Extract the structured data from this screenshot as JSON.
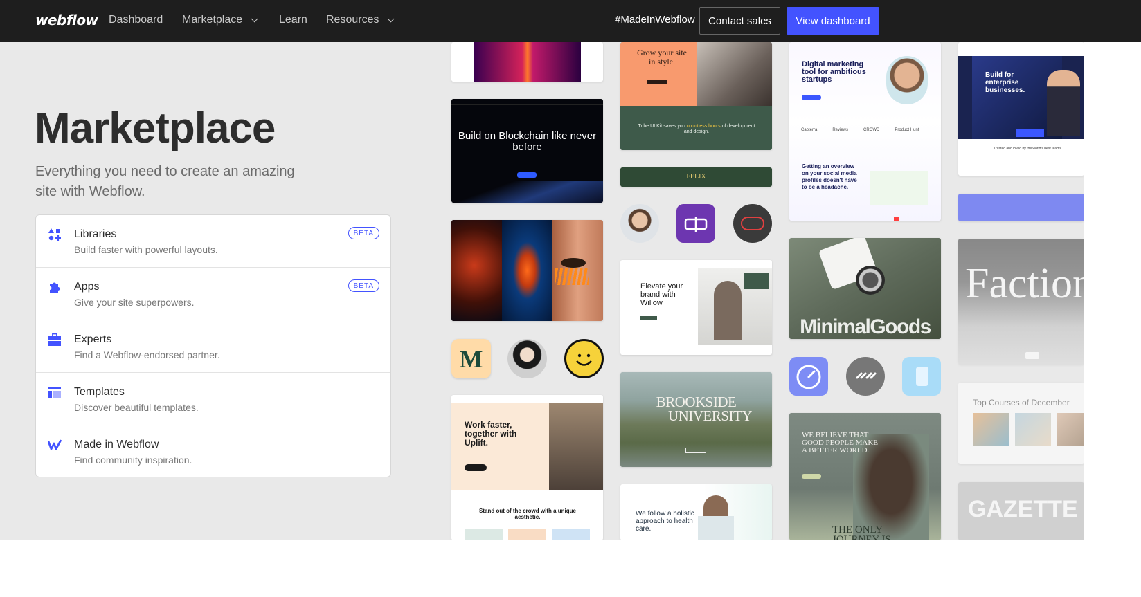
{
  "nav": {
    "logo": "webflow",
    "links": [
      {
        "label": "Dashboard",
        "has_dropdown": false
      },
      {
        "label": "Marketplace",
        "has_dropdown": true
      },
      {
        "label": "Learn",
        "has_dropdown": false
      },
      {
        "label": "Resources",
        "has_dropdown": true
      }
    ],
    "made_in_webflow": "#MadeInWebflow",
    "contact_sales": "Contact sales",
    "view_dashboard": "View dashboard"
  },
  "hero": {
    "title": "Marketplace",
    "subtitle": "Everything you need to create an amazing site with Webflow."
  },
  "menu": [
    {
      "title": "Libraries",
      "desc": "Build faster with powerful layouts.",
      "badge": "BETA",
      "icon": "libraries-icon"
    },
    {
      "title": "Apps",
      "desc": "Give your site superpowers.",
      "badge": "BETA",
      "icon": "puzzle-icon"
    },
    {
      "title": "Experts",
      "desc": "Find a Webflow-endorsed partner.",
      "badge": "",
      "icon": "briefcase-icon"
    },
    {
      "title": "Templates",
      "desc": "Discover beautiful templates.",
      "badge": "",
      "icon": "template-icon"
    },
    {
      "title": "Made in Webflow",
      "desc": "Find community inspiration.",
      "badge": "",
      "icon": "webflow-w-icon"
    }
  ],
  "gallery": {
    "blockchain": {
      "headline": "Build on Blockchain like never before"
    },
    "grow": {
      "headline": "Grow your site in style.",
      "caption_pre": "Tribe UI Kit saves you ",
      "caption_highlight": "countless hours",
      "caption_post": " of development and design."
    },
    "felix": {
      "label": "FELIX"
    },
    "uplift": {
      "headline": "Work faster, together with Uplift.",
      "footer": "Stand out of the crowd with a unique aesthetic."
    },
    "willow": {
      "headline": "Elevate your brand with Willow"
    },
    "brookside": {
      "line1": "BROOKSIDE",
      "line2": "UNIVERSITY"
    },
    "health": {
      "headline": "We follow a holistic approach to health care."
    },
    "digital": {
      "headline": "Digital marketing tool for ambitious startups",
      "sub": "Getting an overview on your social media profiles doesn't have to be a headache.",
      "logos": [
        "Capterra",
        "Reviews",
        "CROWD",
        "Product Hunt"
      ]
    },
    "minimal": {
      "label": "MinimalGoods"
    },
    "believe": {
      "headline": "WE BELIEVE THAT GOOD PEOPLE MAKE A BETTER WORLD.",
      "footer": "THE ONLY JOURNEY IS"
    },
    "enterprise": {
      "headline": "Build for enterprise businesses.",
      "trusted": "Trusted and loved by the world's best teams"
    },
    "faction": {
      "label": "Faction"
    },
    "courses": {
      "label": "Top Courses of December"
    },
    "gazette": {
      "label": "GAZETTE"
    },
    "m_logo": "M"
  },
  "colors": {
    "nav_bg": "#1e1e1e",
    "accent": "#4353ff",
    "page_bg": "#e9e9e9"
  }
}
